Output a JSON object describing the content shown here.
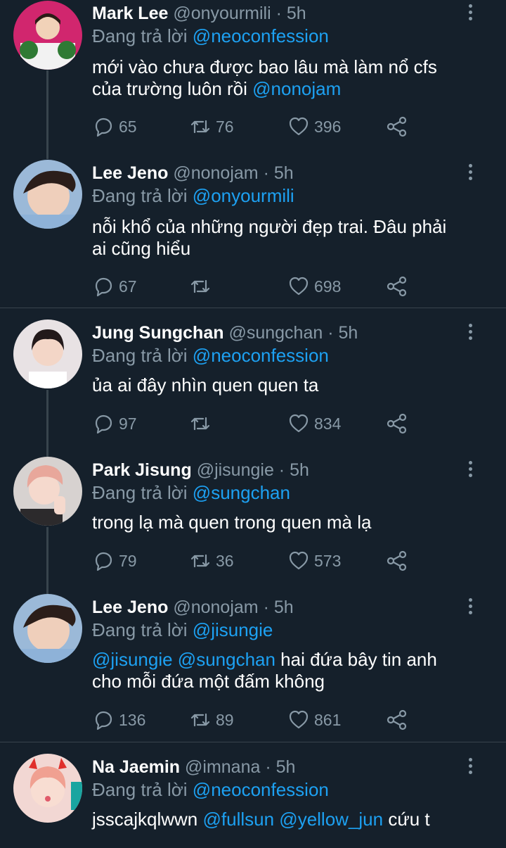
{
  "reply_prefix": "Đang trả lời",
  "tweets": [
    {
      "name": "Mark Lee",
      "handle": "@onyourmili",
      "time": "· 5h",
      "reply_to": "@neoconfession",
      "text_line1": "mới vào chưa được bao lâu mà làm nổ cfs",
      "text_line2_pre": "của trường luôn rồi ",
      "text_line2_mention": "@nonojam",
      "replies": "65",
      "retweets": "76",
      "likes": "396"
    },
    {
      "name": "Lee Jeno",
      "handle": "@nonojam",
      "time": "· 5h",
      "reply_to": "@onyourmili",
      "text_line1": "nỗi khổ của những người đẹp trai. Đâu phải",
      "text_line2": "ai cũng hiểu",
      "replies": "67",
      "retweets": "",
      "likes": "698"
    },
    {
      "name": "Jung Sungchan",
      "handle": "@sungchan",
      "time": "· 5h",
      "reply_to": "@neoconfession",
      "text_line1": "ủa ai đây nhìn quen quen ta",
      "replies": "97",
      "retweets": "",
      "likes": "834"
    },
    {
      "name": "Park Jisung",
      "handle": "@jisungie",
      "time": "· 5h",
      "reply_to": "@sungchan",
      "text_line1": "trong lạ mà quen trong quen mà lạ",
      "replies": "79",
      "retweets": "36",
      "likes": "573"
    },
    {
      "name": "Lee Jeno",
      "handle": "@nonojam",
      "time": "· 5h",
      "reply_to": "@jisungie",
      "text_mention1": "@jisungie",
      "text_mention2": "@sungchan",
      "text_line1_rest": " hai đứa bây tin anh",
      "text_line2": "cho mỗi đứa một đấm không",
      "replies": "136",
      "retweets": "89",
      "likes": "861"
    },
    {
      "name": "Na Jaemin",
      "handle": "@imnana",
      "time": "· 5h",
      "reply_to": "@neoconfession",
      "text_pre": "jsscajkqlwwn ",
      "text_mention1": "@fullsun",
      "text_mention2": "@yellow_jun",
      "text_post": " cứu t"
    }
  ],
  "colors": {
    "background": "#15202b",
    "muted": "#8899a6",
    "accent": "#1da1f2",
    "divider": "#38444d"
  }
}
